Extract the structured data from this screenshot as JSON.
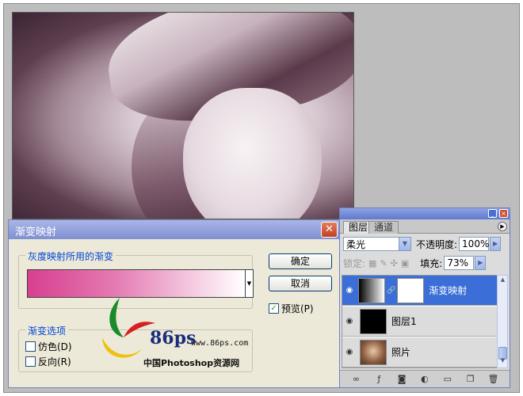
{
  "dialog": {
    "title": "渐变映射",
    "close_glyph": "✕",
    "gradient_group_label": "灰度映射所用的渐变",
    "options_group_label": "渐变选项",
    "ok_label": "确定",
    "cancel_label": "取消",
    "preview_label": "预览(P)",
    "preview_checked": true,
    "dither_label": "仿色(D)",
    "dither_checked": false,
    "reverse_label": "反向(R)",
    "reverse_checked": false,
    "gradient_colors": [
      "#d83f8f",
      "#ffffff"
    ]
  },
  "watermark": {
    "logo_text": "86ps",
    "url": "www.86ps.com",
    "caption": "中国Photoshop资源网"
  },
  "layers_panel": {
    "tabs": [
      {
        "label": "图层",
        "active": true
      },
      {
        "label": "通道",
        "active": false
      }
    ],
    "blend_mode": "柔光",
    "opacity_label": "不透明度:",
    "opacity_value": "100%",
    "lock_label": "锁定:",
    "fill_label": "填充:",
    "fill_value": "73%",
    "layers": [
      {
        "name": "渐变映射",
        "selected": true,
        "visible": true
      },
      {
        "name": "图层1",
        "selected": false,
        "visible": true
      },
      {
        "name": "照片",
        "selected": false,
        "visible": true
      }
    ],
    "footer_icons": [
      "link-icon",
      "fx-icon",
      "mask-icon",
      "adjustment-icon",
      "group-icon",
      "new-layer-icon",
      "trash-icon"
    ]
  },
  "colors": {
    "dialog_bg": "#ece9d8",
    "title_bar": "#7f8fd2",
    "selected_layer": "#3b6ed6",
    "label_blue": "#0046d5"
  }
}
